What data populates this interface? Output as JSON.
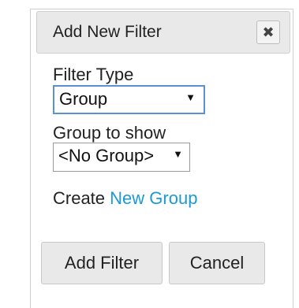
{
  "dialog": {
    "title": "Add New Filter",
    "close_icon": "close-icon"
  },
  "filter_type": {
    "label": "Filter Type",
    "selected": "Group"
  },
  "group_to_show": {
    "label": "Group to show",
    "selected": "<No Group>"
  },
  "create": {
    "prefix": "Create",
    "link": "New Group"
  },
  "buttons": {
    "add": "Add Filter",
    "cancel": "Cancel"
  },
  "colors": {
    "link": "#1a9ad6",
    "titlebar_bg": "#e9e9e9",
    "focus_border": "#5b8fd6"
  },
  "arrow_glyph": "▼",
  "close_glyph": "✖"
}
